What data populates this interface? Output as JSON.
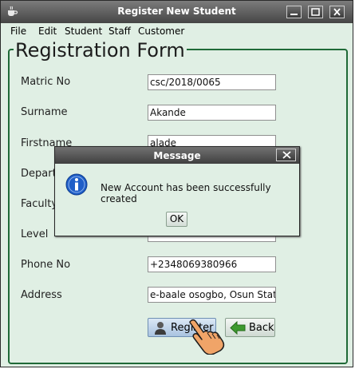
{
  "window": {
    "title": "Register New Student",
    "menu": [
      "File",
      "Edit",
      "Student",
      "Staff",
      "Customer"
    ]
  },
  "form": {
    "legend": "Registration Form",
    "fields": [
      {
        "label": "Matric No",
        "value": "csc/2018/0065"
      },
      {
        "label": "Surname",
        "value": "Akande"
      },
      {
        "label": "Firstname",
        "value": "alade"
      },
      {
        "label": "Depart",
        "value": ""
      },
      {
        "label": "Faculty",
        "value": ""
      },
      {
        "label": "Level",
        "value": ""
      },
      {
        "label": "Phone No",
        "value": "+2348069380966"
      },
      {
        "label": "Address",
        "value": "e-baale osogbo, Osun State"
      }
    ],
    "register_label": "Register",
    "back_label": "Back"
  },
  "dialog": {
    "title": "Message",
    "message": "New Account has been successfully created",
    "ok_label": "OK"
  },
  "colors": {
    "background": "#e0efe4",
    "frame_border": "#1f6a37",
    "info_icon": "#1f5ec8"
  }
}
